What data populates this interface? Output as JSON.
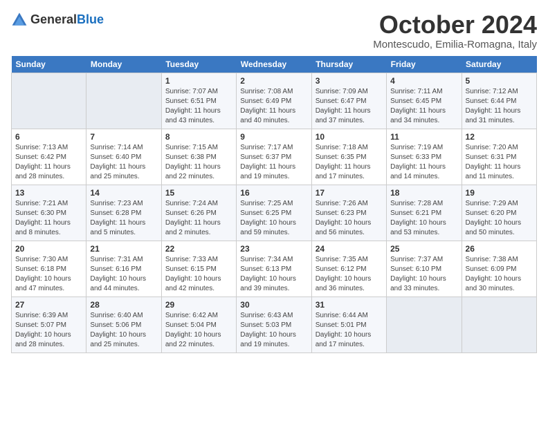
{
  "header": {
    "logo_general": "General",
    "logo_blue": "Blue",
    "month": "October 2024",
    "location": "Montescudo, Emilia-Romagna, Italy"
  },
  "days_of_week": [
    "Sunday",
    "Monday",
    "Tuesday",
    "Wednesday",
    "Thursday",
    "Friday",
    "Saturday"
  ],
  "weeks": [
    [
      {
        "day": "",
        "empty": true
      },
      {
        "day": "",
        "empty": true
      },
      {
        "day": "1",
        "sunrise": "Sunrise: 7:07 AM",
        "sunset": "Sunset: 6:51 PM",
        "daylight": "Daylight: 11 hours and 43 minutes."
      },
      {
        "day": "2",
        "sunrise": "Sunrise: 7:08 AM",
        "sunset": "Sunset: 6:49 PM",
        "daylight": "Daylight: 11 hours and 40 minutes."
      },
      {
        "day": "3",
        "sunrise": "Sunrise: 7:09 AM",
        "sunset": "Sunset: 6:47 PM",
        "daylight": "Daylight: 11 hours and 37 minutes."
      },
      {
        "day": "4",
        "sunrise": "Sunrise: 7:11 AM",
        "sunset": "Sunset: 6:45 PM",
        "daylight": "Daylight: 11 hours and 34 minutes."
      },
      {
        "day": "5",
        "sunrise": "Sunrise: 7:12 AM",
        "sunset": "Sunset: 6:44 PM",
        "daylight": "Daylight: 11 hours and 31 minutes."
      }
    ],
    [
      {
        "day": "6",
        "sunrise": "Sunrise: 7:13 AM",
        "sunset": "Sunset: 6:42 PM",
        "daylight": "Daylight: 11 hours and 28 minutes."
      },
      {
        "day": "7",
        "sunrise": "Sunrise: 7:14 AM",
        "sunset": "Sunset: 6:40 PM",
        "daylight": "Daylight: 11 hours and 25 minutes."
      },
      {
        "day": "8",
        "sunrise": "Sunrise: 7:15 AM",
        "sunset": "Sunset: 6:38 PM",
        "daylight": "Daylight: 11 hours and 22 minutes."
      },
      {
        "day": "9",
        "sunrise": "Sunrise: 7:17 AM",
        "sunset": "Sunset: 6:37 PM",
        "daylight": "Daylight: 11 hours and 19 minutes."
      },
      {
        "day": "10",
        "sunrise": "Sunrise: 7:18 AM",
        "sunset": "Sunset: 6:35 PM",
        "daylight": "Daylight: 11 hours and 17 minutes."
      },
      {
        "day": "11",
        "sunrise": "Sunrise: 7:19 AM",
        "sunset": "Sunset: 6:33 PM",
        "daylight": "Daylight: 11 hours and 14 minutes."
      },
      {
        "day": "12",
        "sunrise": "Sunrise: 7:20 AM",
        "sunset": "Sunset: 6:31 PM",
        "daylight": "Daylight: 11 hours and 11 minutes."
      }
    ],
    [
      {
        "day": "13",
        "sunrise": "Sunrise: 7:21 AM",
        "sunset": "Sunset: 6:30 PM",
        "daylight": "Daylight: 11 hours and 8 minutes."
      },
      {
        "day": "14",
        "sunrise": "Sunrise: 7:23 AM",
        "sunset": "Sunset: 6:28 PM",
        "daylight": "Daylight: 11 hours and 5 minutes."
      },
      {
        "day": "15",
        "sunrise": "Sunrise: 7:24 AM",
        "sunset": "Sunset: 6:26 PM",
        "daylight": "Daylight: 11 hours and 2 minutes."
      },
      {
        "day": "16",
        "sunrise": "Sunrise: 7:25 AM",
        "sunset": "Sunset: 6:25 PM",
        "daylight": "Daylight: 10 hours and 59 minutes."
      },
      {
        "day": "17",
        "sunrise": "Sunrise: 7:26 AM",
        "sunset": "Sunset: 6:23 PM",
        "daylight": "Daylight: 10 hours and 56 minutes."
      },
      {
        "day": "18",
        "sunrise": "Sunrise: 7:28 AM",
        "sunset": "Sunset: 6:21 PM",
        "daylight": "Daylight: 10 hours and 53 minutes."
      },
      {
        "day": "19",
        "sunrise": "Sunrise: 7:29 AM",
        "sunset": "Sunset: 6:20 PM",
        "daylight": "Daylight: 10 hours and 50 minutes."
      }
    ],
    [
      {
        "day": "20",
        "sunrise": "Sunrise: 7:30 AM",
        "sunset": "Sunset: 6:18 PM",
        "daylight": "Daylight: 10 hours and 47 minutes."
      },
      {
        "day": "21",
        "sunrise": "Sunrise: 7:31 AM",
        "sunset": "Sunset: 6:16 PM",
        "daylight": "Daylight: 10 hours and 44 minutes."
      },
      {
        "day": "22",
        "sunrise": "Sunrise: 7:33 AM",
        "sunset": "Sunset: 6:15 PM",
        "daylight": "Daylight: 10 hours and 42 minutes."
      },
      {
        "day": "23",
        "sunrise": "Sunrise: 7:34 AM",
        "sunset": "Sunset: 6:13 PM",
        "daylight": "Daylight: 10 hours and 39 minutes."
      },
      {
        "day": "24",
        "sunrise": "Sunrise: 7:35 AM",
        "sunset": "Sunset: 6:12 PM",
        "daylight": "Daylight: 10 hours and 36 minutes."
      },
      {
        "day": "25",
        "sunrise": "Sunrise: 7:37 AM",
        "sunset": "Sunset: 6:10 PM",
        "daylight": "Daylight: 10 hours and 33 minutes."
      },
      {
        "day": "26",
        "sunrise": "Sunrise: 7:38 AM",
        "sunset": "Sunset: 6:09 PM",
        "daylight": "Daylight: 10 hours and 30 minutes."
      }
    ],
    [
      {
        "day": "27",
        "sunrise": "Sunrise: 6:39 AM",
        "sunset": "Sunset: 5:07 PM",
        "daylight": "Daylight: 10 hours and 28 minutes."
      },
      {
        "day": "28",
        "sunrise": "Sunrise: 6:40 AM",
        "sunset": "Sunset: 5:06 PM",
        "daylight": "Daylight: 10 hours and 25 minutes."
      },
      {
        "day": "29",
        "sunrise": "Sunrise: 6:42 AM",
        "sunset": "Sunset: 5:04 PM",
        "daylight": "Daylight: 10 hours and 22 minutes."
      },
      {
        "day": "30",
        "sunrise": "Sunrise: 6:43 AM",
        "sunset": "Sunset: 5:03 PM",
        "daylight": "Daylight: 10 hours and 19 minutes."
      },
      {
        "day": "31",
        "sunrise": "Sunrise: 6:44 AM",
        "sunset": "Sunset: 5:01 PM",
        "daylight": "Daylight: 10 hours and 17 minutes."
      },
      {
        "day": "",
        "empty": true
      },
      {
        "day": "",
        "empty": true
      }
    ]
  ]
}
